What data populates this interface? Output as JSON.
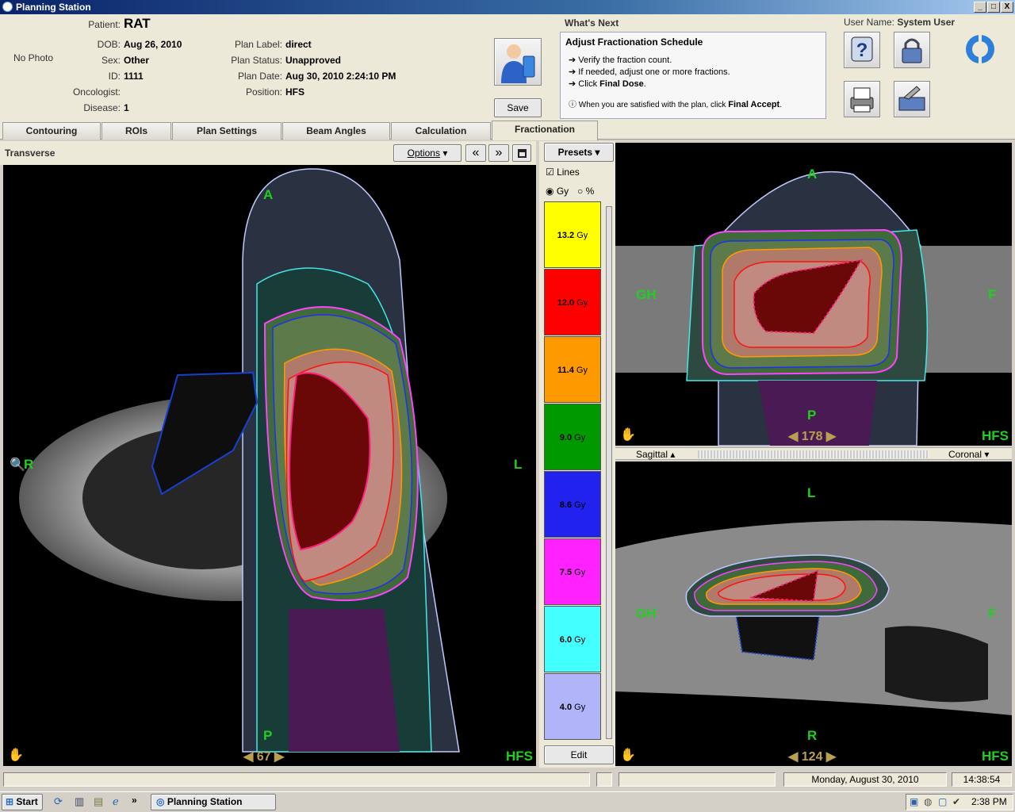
{
  "window": {
    "title": "Planning Station",
    "buttons": [
      "_",
      "□",
      "X"
    ]
  },
  "patient": {
    "label": "Patient:",
    "name": "RAT",
    "photo": "No Photo",
    "fields": [
      {
        "label": "DOB:",
        "value": "Aug 26, 2010"
      },
      {
        "label": "Sex:",
        "value": "Other"
      },
      {
        "label": "ID:",
        "value": "1111"
      },
      {
        "label": "Oncologist:",
        "value": ""
      },
      {
        "label": "Disease:",
        "value": "1"
      }
    ]
  },
  "plan": {
    "fields": [
      {
        "label": "Plan Label:",
        "value": "direct"
      },
      {
        "label": "Plan Status:",
        "value": "Unapproved"
      },
      {
        "label": "Plan Date:",
        "value": "Aug 30, 2010 2:24:10 PM"
      },
      {
        "label": "Position:",
        "value": "HFS"
      }
    ]
  },
  "save_button": "Save",
  "whats_next": {
    "heading": "What's Next",
    "title": "Adjust Fractionation Schedule",
    "steps": [
      "Verify the fraction count.",
      "If needed, adjust one or more fractions.",
      "Click "
    ],
    "step3_bold": "Final Dose",
    "step3_end": ".",
    "note": "When you are satisfied with the plan, click ",
    "note_bold": "Final Accept",
    "note_end": "."
  },
  "user": {
    "label": "User Name:",
    "name": "System User"
  },
  "tabs": [
    "Contouring",
    "ROIs",
    "Plan Settings",
    "Beam Angles",
    "Calculation",
    "Fractionation"
  ],
  "transverse": {
    "title": "Transverse",
    "options_label": "Options",
    "labels": {
      "top": "A",
      "bottom": "P",
      "left": "R",
      "right": "L",
      "orientation": "HFS"
    },
    "slice": "67"
  },
  "coronal_view": {
    "labels": {
      "top": "A",
      "bottom": "P",
      "left": "GH",
      "right": "F",
      "orientation": "HFS"
    },
    "slice": "178"
  },
  "sagittal_view": {
    "labels": {
      "top": "L",
      "bottom": "R",
      "left": "GH",
      "right": "F",
      "orientation": "HFS"
    },
    "slice": "124"
  },
  "view_selectors": {
    "left": "Sagittal",
    "right": "Coronal"
  },
  "legend": {
    "presets_label": "Presets",
    "lines_label": "Lines",
    "unit_gy": "Gy",
    "unit_pct": "%",
    "edit_label": "Edit",
    "items": [
      {
        "value": "13.2",
        "unit": "Gy",
        "color": "#ffff00"
      },
      {
        "value": "12.0",
        "unit": "Gy",
        "color": "#ff0000"
      },
      {
        "value": "11.4",
        "unit": "Gy",
        "color": "#ff9900"
      },
      {
        "value": "9.0",
        "unit": "Gy",
        "color": "#009900"
      },
      {
        "value": "8.6",
        "unit": "Gy",
        "color": "#2222ee"
      },
      {
        "value": "7.5",
        "unit": "Gy",
        "color": "#ff22ff"
      },
      {
        "value": "6.0",
        "unit": "Gy",
        "color": "#44ffff"
      },
      {
        "value": "4.0",
        "unit": "Gy",
        "color": "#b0b4f8"
      }
    ]
  },
  "status": {
    "date": "Monday, August 30, 2010",
    "time": "14:38:54"
  },
  "taskbar": {
    "start": "Start",
    "task": "Planning Station",
    "clock": "2:38 PM",
    "chevron": "»"
  }
}
